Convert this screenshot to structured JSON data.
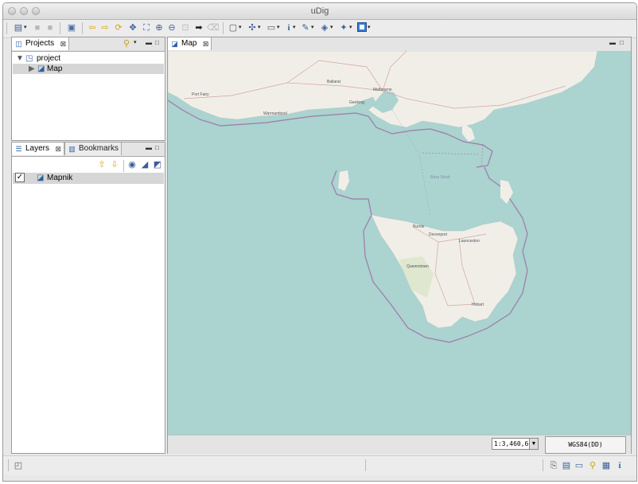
{
  "window": {
    "title": "uDig"
  },
  "projects_view": {
    "tab_label": "Projects",
    "tree": [
      {
        "label": "project",
        "expanded": true
      },
      {
        "label": "Map",
        "selected": true
      }
    ]
  },
  "layers_view": {
    "tabs": [
      {
        "label": "Layers"
      },
      {
        "label": "Bookmarks"
      }
    ],
    "layers": [
      {
        "label": "Mapnik",
        "checked": true
      }
    ]
  },
  "map_editor": {
    "tab_label": "Map",
    "scale": "1:3,460,6§",
    "crs": "WGS84(DD)",
    "place_labels": [
      "Ballarat",
      "Melbourne",
      "Geelong",
      "Port Fairy",
      "Warrnambool",
      "Burnie",
      "Devonport",
      "Launceston",
      "Hobart",
      "Queenstown",
      "Bass Strait"
    ]
  },
  "colors": {
    "sea": "#abd3d0",
    "land": "#f1eee8",
    "boundary": "#9e7aa8",
    "park": "#c8d7ab",
    "selection": "#d6d6d6"
  },
  "toolbar_icons": [
    "new-icon",
    "save-icon",
    "save-all-icon",
    "print-icon",
    "back-icon",
    "forward-icon",
    "refresh-icon",
    "zoom-extent-icon",
    "zoom-full-icon",
    "zoom-in-icon",
    "zoom-out-icon",
    "zoom-previous-icon",
    "pan-right-icon",
    "eraser-icon",
    "select-tool-icon",
    "pan-tool-icon",
    "box-select-icon",
    "info-icon",
    "edit-tool-icon",
    "layer-tool-icon",
    "wand-icon",
    "frame-icon"
  ]
}
